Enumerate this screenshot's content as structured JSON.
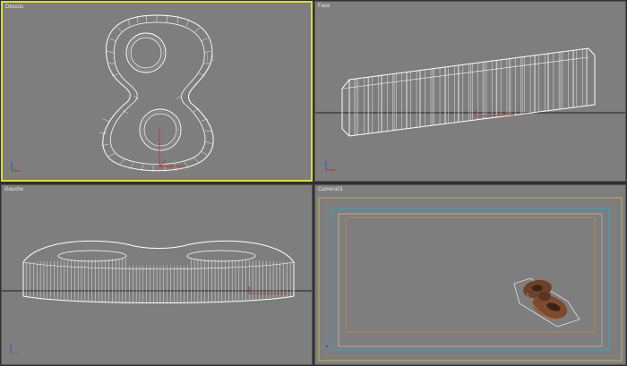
{
  "viewports": {
    "top": {
      "label": "Dessus"
    },
    "front": {
      "label": "Face"
    },
    "left": {
      "label": "Gauche"
    },
    "camera": {
      "label": "Camera01"
    }
  },
  "colors": {
    "viewport_bg": "#7e7e7e",
    "active_border": "#dede2c",
    "wireframe": "#ffffff",
    "gizmo_red": "#c0392b",
    "safe_frame_yellow": "#c9c33a",
    "safe_frame_blue": "#2aa6c7",
    "safe_frame_orange": "#c98a3a",
    "object_material": "#7a4a30"
  },
  "icons": [
    "axis-tripod-icon",
    "transform-gizmo-icon",
    "camera-object-icon"
  ]
}
